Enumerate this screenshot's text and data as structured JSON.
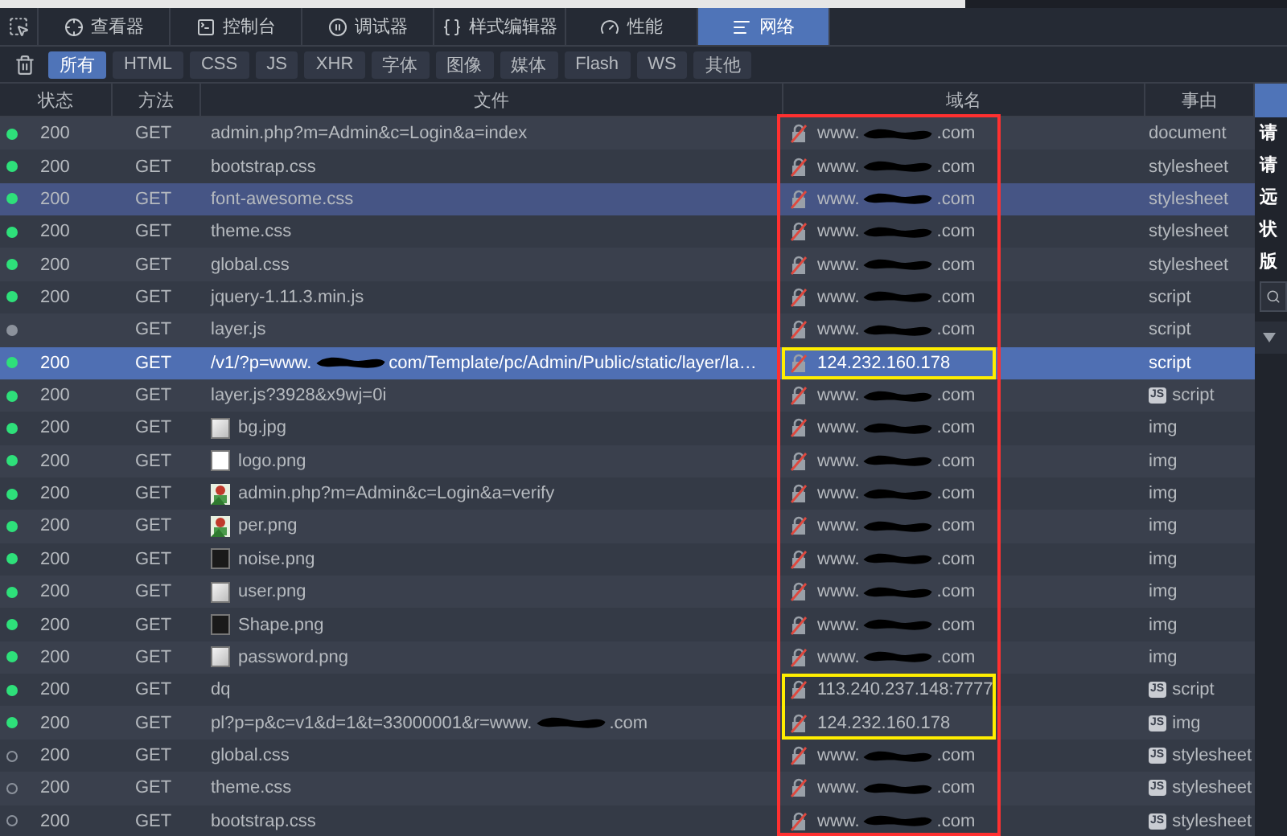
{
  "toolbar": {
    "tabs": [
      {
        "label": "查看器",
        "selected": false
      },
      {
        "label": "控制台",
        "selected": false
      },
      {
        "label": "调试器",
        "selected": false
      },
      {
        "label": "样式编辑器",
        "selected": false
      },
      {
        "label": "性能",
        "selected": false
      },
      {
        "label": "网络",
        "selected": true
      }
    ]
  },
  "filters": [
    {
      "label": "所有",
      "selected": true
    },
    {
      "label": "HTML",
      "selected": false
    },
    {
      "label": "CSS",
      "selected": false
    },
    {
      "label": "JS",
      "selected": false
    },
    {
      "label": "XHR",
      "selected": false
    },
    {
      "label": "字体",
      "selected": false
    },
    {
      "label": "图像",
      "selected": false
    },
    {
      "label": "媒体",
      "selected": false
    },
    {
      "label": "Flash",
      "selected": false
    },
    {
      "label": "WS",
      "selected": false
    },
    {
      "label": "其他",
      "selected": false
    }
  ],
  "table": {
    "columns": [
      "状态",
      "方法",
      "文件",
      "域名",
      "事由"
    ],
    "domain_column_outlined": true,
    "rows": [
      {
        "finished": true,
        "from_cache": false,
        "status": "200",
        "method": "GET",
        "file": [
          "admin.php?m=Admin&c=Login&a=index"
        ],
        "domain": [
          "www.",
          ".com"
        ],
        "cause": {
          "label": "document"
        },
        "selected": false,
        "hovered": false,
        "marked": false
      },
      {
        "finished": true,
        "from_cache": false,
        "status": "200",
        "method": "GET",
        "file": [
          "bootstrap.css"
        ],
        "domain": [
          "www.",
          ".com"
        ],
        "cause": {
          "label": "stylesheet"
        },
        "selected": false,
        "hovered": false,
        "marked": false
      },
      {
        "finished": true,
        "from_cache": false,
        "status": "200",
        "method": "GET",
        "file": [
          "font-awesome.css"
        ],
        "domain": [
          "www.",
          ".com"
        ],
        "cause": {
          "label": "stylesheet"
        },
        "selected": false,
        "hovered": true,
        "marked": false
      },
      {
        "finished": true,
        "from_cache": false,
        "status": "200",
        "method": "GET",
        "file": [
          "theme.css"
        ],
        "domain": [
          "www.",
          ".com"
        ],
        "cause": {
          "label": "stylesheet"
        },
        "selected": false,
        "hovered": false,
        "marked": false
      },
      {
        "finished": true,
        "from_cache": false,
        "status": "200",
        "method": "GET",
        "file": [
          "global.css"
        ],
        "domain": [
          "www.",
          ".com"
        ],
        "cause": {
          "label": "stylesheet"
        },
        "selected": false,
        "hovered": false,
        "marked": false
      },
      {
        "finished": true,
        "from_cache": false,
        "status": "200",
        "method": "GET",
        "file": [
          "jquery-1.11.3.min.js"
        ],
        "domain": [
          "www.",
          ".com"
        ],
        "cause": {
          "label": "script"
        },
        "selected": false,
        "hovered": false,
        "marked": false
      },
      {
        "finished": false,
        "from_cache": false,
        "method": "GET",
        "file": [
          "layer.js"
        ],
        "domain": [
          "www.",
          ".com"
        ],
        "cause": {
          "label": "script"
        },
        "selected": false,
        "hovered": false,
        "marked": false
      },
      {
        "finished": true,
        "from_cache": false,
        "status": "200",
        "method": "GET",
        "file": [
          "/v1/?p=www.",
          "com/Template/pc/Admin/Public/static/layer/la…"
        ],
        "domain": [
          "124.232.160.178"
        ],
        "cause": {
          "label": "script"
        },
        "selected": true,
        "hovered": false,
        "marked": true
      },
      {
        "finished": true,
        "from_cache": false,
        "status": "200",
        "method": "GET",
        "file": [
          "layer.js?3928&x9wj=0i"
        ],
        "domain": [
          "www.",
          ".com"
        ],
        "cause": {
          "badge": "JS",
          "label": "script"
        },
        "selected": false,
        "hovered": false,
        "marked": false
      },
      {
        "finished": true,
        "from_cache": false,
        "status": "200",
        "method": "GET",
        "kind": "light",
        "file": [
          "bg.jpg"
        ],
        "domain": [
          "www.",
          ".com"
        ],
        "cause": {
          "label": "img"
        },
        "selected": false,
        "hovered": false,
        "marked": false
      },
      {
        "finished": true,
        "from_cache": false,
        "status": "200",
        "method": "GET",
        "kind": "white",
        "file": [
          "logo.png"
        ],
        "domain": [
          "www.",
          ".com"
        ],
        "cause": {
          "label": "img"
        },
        "selected": false,
        "hovered": false,
        "marked": false
      },
      {
        "finished": true,
        "from_cache": false,
        "status": "200",
        "method": "GET",
        "kind": "picture",
        "file": [
          "admin.php?m=Admin&c=Login&a=verify"
        ],
        "domain": [
          "www.",
          ".com"
        ],
        "cause": {
          "label": "img"
        },
        "selected": false,
        "hovered": false,
        "marked": false
      },
      {
        "finished": true,
        "from_cache": false,
        "status": "200",
        "method": "GET",
        "kind": "picture",
        "file": [
          "per.png"
        ],
        "domain": [
          "www.",
          ".com"
        ],
        "cause": {
          "label": "img"
        },
        "selected": false,
        "hovered": false,
        "marked": false
      },
      {
        "finished": true,
        "from_cache": false,
        "status": "200",
        "method": "GET",
        "kind": "dark",
        "file": [
          "noise.png"
        ],
        "domain": [
          "www.",
          ".com"
        ],
        "cause": {
          "label": "img"
        },
        "selected": false,
        "hovered": false,
        "marked": false
      },
      {
        "finished": true,
        "from_cache": false,
        "status": "200",
        "method": "GET",
        "kind": "light",
        "file": [
          "user.png"
        ],
        "domain": [
          "www.",
          ".com"
        ],
        "cause": {
          "label": "img"
        },
        "selected": false,
        "hovered": false,
        "marked": false
      },
      {
        "finished": true,
        "from_cache": false,
        "status": "200",
        "method": "GET",
        "kind": "dark",
        "file": [
          "Shape.png"
        ],
        "domain": [
          "www.",
          ".com"
        ],
        "cause": {
          "label": "img"
        },
        "selected": false,
        "hovered": false,
        "marked": false
      },
      {
        "finished": true,
        "from_cache": false,
        "status": "200",
        "method": "GET",
        "kind": "light",
        "file": [
          "password.png"
        ],
        "domain": [
          "www.",
          ".com"
        ],
        "cause": {
          "label": "img"
        },
        "selected": false,
        "hovered": false,
        "marked": false
      },
      {
        "finished": true,
        "from_cache": false,
        "status": "200",
        "method": "GET",
        "file": [
          "dq"
        ],
        "domain": [
          "113.240.237.148:7777"
        ],
        "cause": {
          "badge": "JS",
          "label": "script"
        },
        "selected": false,
        "hovered": false,
        "marked": true
      },
      {
        "finished": true,
        "from_cache": false,
        "status": "200",
        "method": "GET",
        "file": [
          "pl?p=p&c=v1&d=1&t=33000001&r=www.",
          ".com"
        ],
        "domain": [
          "124.232.160.178"
        ],
        "cause": {
          "badge": "JS",
          "label": "img"
        },
        "selected": false,
        "hovered": false,
        "marked": true
      },
      {
        "finished": true,
        "from_cache": true,
        "status": "200",
        "method": "GET",
        "file": [
          "global.css"
        ],
        "domain": [
          "www.",
          ".com"
        ],
        "cause": {
          "badge": "JS",
          "label": "stylesheet"
        },
        "selected": false,
        "hovered": false,
        "marked": false
      },
      {
        "finished": true,
        "from_cache": true,
        "status": "200",
        "method": "GET",
        "file": [
          "theme.css"
        ],
        "domain": [
          "www.",
          ".com"
        ],
        "cause": {
          "badge": "JS",
          "label": "stylesheet"
        },
        "selected": false,
        "hovered": false,
        "marked": false
      },
      {
        "finished": true,
        "from_cache": true,
        "status": "200",
        "method": "GET",
        "file": [
          "bootstrap.css"
        ],
        "domain": [
          "www.",
          ".com"
        ],
        "cause": {
          "badge": "JS",
          "label": "stylesheet"
        },
        "selected": false,
        "hovered": false,
        "marked": false
      }
    ]
  },
  "side_panel": {
    "labels": [
      "请",
      "请",
      "远",
      "状",
      "版"
    ]
  }
}
